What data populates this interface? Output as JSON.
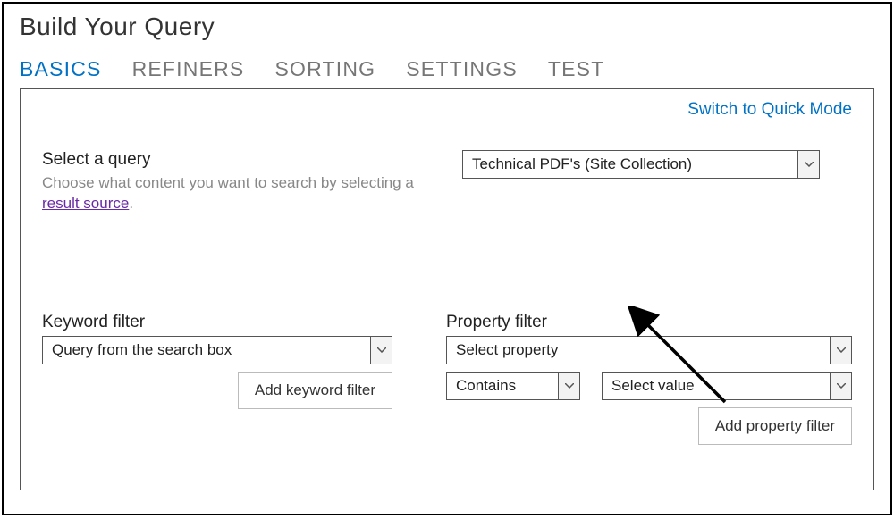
{
  "title": "Build Your Query",
  "tabs": {
    "basics": "BASICS",
    "refiners": "REFINERS",
    "sorting": "SORTING",
    "settings": "SETTINGS",
    "test": "TEST"
  },
  "switch_link": "Switch to Quick Mode",
  "select_query": {
    "label": "Select a query",
    "help_prefix": "Choose what content you want to search by selecting a ",
    "help_link": "result source",
    "help_suffix": ".",
    "value": "Technical PDF's (Site Collection)"
  },
  "keyword_filter": {
    "label": "Keyword filter",
    "value": "Query from the search box",
    "button": "Add keyword filter"
  },
  "property_filter": {
    "label": "Property filter",
    "property_value": "Select property",
    "operator_value": "Contains",
    "value_value": "Select value",
    "button": "Add property filter"
  }
}
